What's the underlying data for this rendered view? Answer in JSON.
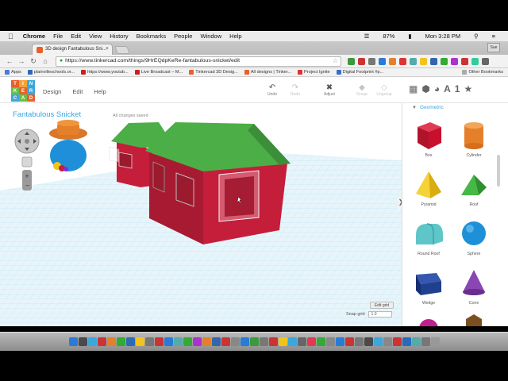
{
  "menubar": {
    "app_name": "Chrome",
    "items": [
      "File",
      "Edit",
      "View",
      "History",
      "Bookmarks",
      "People",
      "Window",
      "Help"
    ],
    "battery": "87%",
    "clock": "Mon 3:28 PM",
    "icons": [
      "apple-icon",
      "wifi-icon",
      "battery-icon",
      "search-icon",
      "list-icon"
    ]
  },
  "browser": {
    "tab_title": "3D design Fantabulous Sni...",
    "user_button": "Sue",
    "url": "https://www.tinkercad.com/things/9HrEQdpKeRe-fantabulous-snicket/edit",
    "bookmarks": [
      {
        "label": "Apps",
        "color": "#4a7bd6"
      },
      {
        "label": "plainvilleschools.or...",
        "color": "#2a6ab8"
      },
      {
        "label": "https://www.youtub...",
        "color": "#cc1f1f"
      },
      {
        "label": "Live Broadcast – M...",
        "color": "#cc1f1f"
      },
      {
        "label": "Tinkercad 3D Desig...",
        "color": "#e8612c"
      },
      {
        "label": "All designs | Tinker...",
        "color": "#e8612c"
      },
      {
        "label": "Project Ignite",
        "color": "#d33"
      },
      {
        "label": "Digital Footprint #p...",
        "color": "#3a6ccf"
      }
    ],
    "other_bookmarks": "Other Bookmarks"
  },
  "tinkercad": {
    "logo_letters": [
      "T",
      "I",
      "N",
      "K",
      "E",
      "R",
      "C",
      "A",
      "D"
    ],
    "logo_colors": [
      "#e8612c",
      "#f6a336",
      "#3aa7dd",
      "#69c043",
      "#e8612c",
      "#3aa7dd",
      "#3aa7dd",
      "#69c043",
      "#e8612c"
    ],
    "nav": [
      "Design",
      "Edit",
      "Help"
    ],
    "tools": {
      "undo": "Undo",
      "redo": "Redo",
      "adjust": "Adjust",
      "group": "Group",
      "ungroup": "Ungroup"
    },
    "design_title": "Fantabulous Snicket",
    "save_status": "All changes saved",
    "edit_grid": "Edit grid",
    "snap_label": "Snap grid",
    "snap_value": "1.0"
  },
  "sidebar": {
    "category": "Geometric",
    "shapes": [
      {
        "label": "Box",
        "color": "#c8102e"
      },
      {
        "label": "Cylinder",
        "color": "#e5802a"
      },
      {
        "label": "Pyramid",
        "color": "#f2c419"
      },
      {
        "label": "Roof",
        "color": "#3aa83a"
      },
      {
        "label": "Round Roof",
        "color": "#5ec6c9"
      },
      {
        "label": "Sphere",
        "color": "#1e90d8"
      },
      {
        "label": "Wedge",
        "color": "#1f3f8f"
      },
      {
        "label": "Cone",
        "color": "#7b3fa0"
      }
    ]
  },
  "colors": {
    "accent": "#3aa7dd",
    "house_wall": "#c41e3a",
    "house_roof": "#4cae47",
    "grid": "#bfe4f2"
  }
}
